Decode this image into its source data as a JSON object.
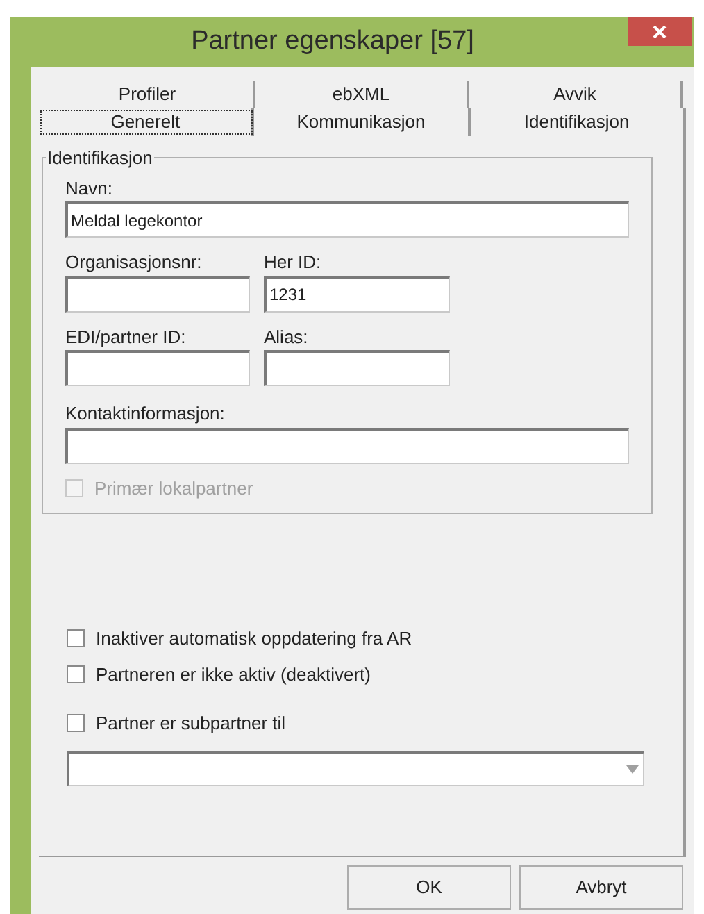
{
  "window": {
    "title": "Partner egenskaper [57]"
  },
  "tab_rows": [
    {
      "tabs": [
        {
          "label": "Profiler",
          "selected": false
        },
        {
          "label": "ebXML",
          "selected": false
        },
        {
          "label": "Avvik",
          "selected": false
        }
      ]
    },
    {
      "tabs": [
        {
          "label": "Generelt",
          "selected": true
        },
        {
          "label": "Kommunikasjon",
          "selected": false
        },
        {
          "label": "Identifikasjon",
          "selected": false
        }
      ]
    }
  ],
  "group": {
    "title": "Identifikasjon",
    "name_field": {
      "label": "Navn:",
      "value": "Meldal legekontor"
    },
    "field_pairs": [
      [
        {
          "label": "Organisasjonsnr:"
        },
        {
          "label": "Her ID:",
          "value": "1231"
        }
      ],
      [
        {
          "label": "EDI/partner ID:"
        },
        {
          "label": "Alias:"
        }
      ]
    ],
    "contact_field": {
      "label": "Kontaktinformasjon:"
    },
    "primary_checkbox": {
      "label": "Primær lokalpartner",
      "checked": false,
      "disabled": true
    }
  },
  "checkboxes": [
    {
      "label": "Inaktiver automatisk oppdatering fra AR",
      "checked": false,
      "disabled": false
    },
    {
      "label": "Partneren er ikke aktiv (deaktivert)",
      "checked": false,
      "disabled": false
    }
  ],
  "subpartner": {
    "label": "Partner er subpartner til",
    "checked": false,
    "disabled": false
  },
  "buttons": [
    "OK",
    "Avbryt"
  ]
}
